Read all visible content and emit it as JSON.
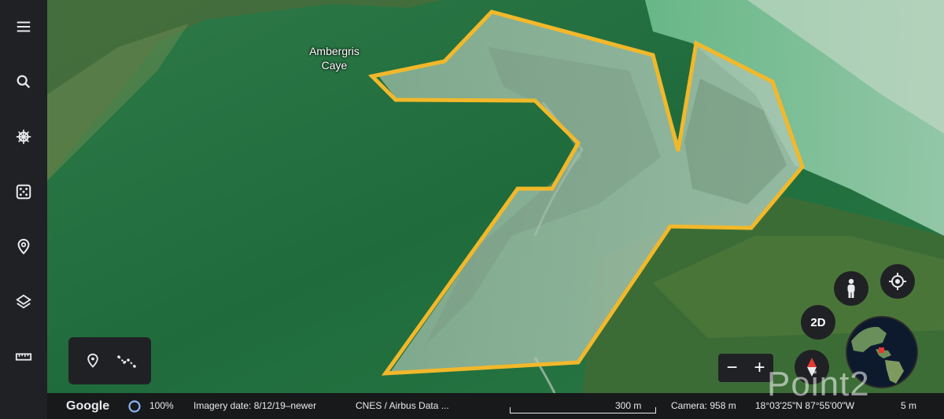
{
  "map": {
    "place_label_line1": "Ambergris",
    "place_label_line2": "Caye",
    "outline_color": "#f2b82a"
  },
  "sidebar": {
    "items": [
      {
        "icon": "menu-icon"
      },
      {
        "icon": "search-icon"
      },
      {
        "icon": "voyager-icon"
      },
      {
        "icon": "feeling-lucky-icon"
      },
      {
        "icon": "projects-icon"
      },
      {
        "icon": "map-style-icon"
      },
      {
        "icon": "measure-icon"
      }
    ]
  },
  "draw_tools": {
    "items": [
      {
        "icon": "placemark-icon"
      },
      {
        "icon": "path-icon"
      }
    ]
  },
  "controls": {
    "view_mode_label": "2D",
    "zoom_out_label": "−",
    "zoom_in_label": "+"
  },
  "status": {
    "brand": "Google",
    "loading_percent": "100%",
    "imagery_date": "Imagery date: 8/12/19–newer",
    "attribution": "CNES / Airbus  Data ...",
    "scale_label": "300 m",
    "camera": "Camera: 958 m",
    "coordinates": "18°03'25\"N 87°55'00\"W",
    "elevation": "5 m"
  },
  "watermark": "Point2",
  "colors": {
    "sidebar": "#202124",
    "statusbar": "#18191b",
    "outline": "#f2b82a"
  }
}
